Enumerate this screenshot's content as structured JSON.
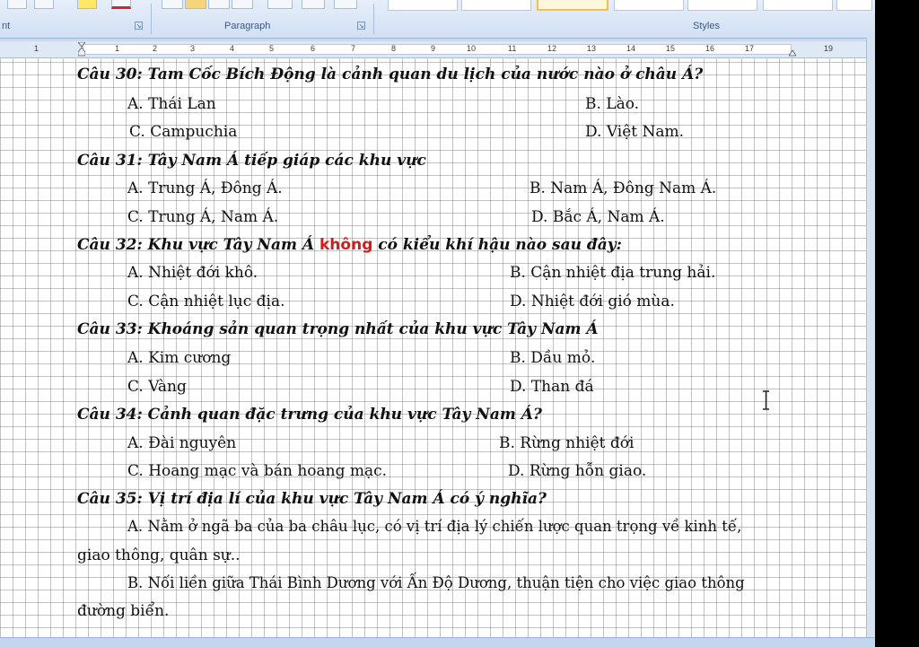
{
  "ribbon": {
    "groups": {
      "font_label": "nt",
      "paragraph_label": "Paragraph",
      "styles_label": "Styles"
    }
  },
  "ruler": {
    "numbers": [
      "1",
      "1",
      "2",
      "3",
      "4",
      "5",
      "6",
      "7",
      "8",
      "9",
      "10",
      "11",
      "12",
      "13",
      "14",
      "15",
      "16",
      "17",
      "19"
    ]
  },
  "document": {
    "q30": {
      "text": "Câu 30: Tam Cốc Bích Động là cảnh quan du lịch của nước nào ở châu Á?",
      "a": "A. Thái Lan",
      "b": "B. Lào.",
      "c": "C. Campuchia",
      "d": "D. Việt Nam."
    },
    "q31": {
      "text": "Câu 31:  Tây Nam Á tiếp giáp các khu vực",
      "a": "A. Trung Á, Đông Á.",
      "b": "B. Nam Á, Đông Nam Á.",
      "c": "C. Trung Á, Nam Á.",
      "d": "D. Bắc Á, Nam Á."
    },
    "q32": {
      "text_before": "Câu 32: Khu vực Tây Nam Á ",
      "text_red": "không",
      "text_after": " có kiểu khí hậu nào sau đây:",
      "a": "A. Nhiệt đới khô.",
      "b": "B. Cận nhiệt địa trung hải.",
      "c": "C. Cận nhiệt lục địa.",
      "d": "D. Nhiệt đới gió mùa."
    },
    "q33": {
      "text": "Câu 33: Khoáng sản quan trọng nhất của khu vực Tây Nam Á",
      "a": "A. Kim  cương",
      "b": "B. Dầu mỏ.",
      "c": "C. Vàng",
      "d": "D. Than đá"
    },
    "q34": {
      "text": "Câu 34: Cảnh quan đặc trưng của khu vực Tây Nam Á?",
      "a": "A. Đài nguyên",
      "b": "B. Rừng nhiệt đới",
      "c": "C. Hoang mạc và bán hoang mạc.",
      "d": "D. Rừng hỗn giao."
    },
    "q35": {
      "text": "Câu 35: Vị trí địa lí của khu vực Tây Nam Á có ý nghĩa?",
      "a_line1": "A. Nằm ở ngã ba của ba châu lục,  có vị trí địa lý chiến lược quan trọng về kinh tế,",
      "a_line2": "giao thông, quân sự..",
      "b_line1": "B. Nối liền giữa Thái Bình Dương với Ấn Độ Dương, thuận tiện cho việc giao thông",
      "b_line2": "đường biển."
    }
  },
  "colors": {
    "accent_red": "#d21b1b",
    "ribbon_bg": "#d2e0f3"
  }
}
